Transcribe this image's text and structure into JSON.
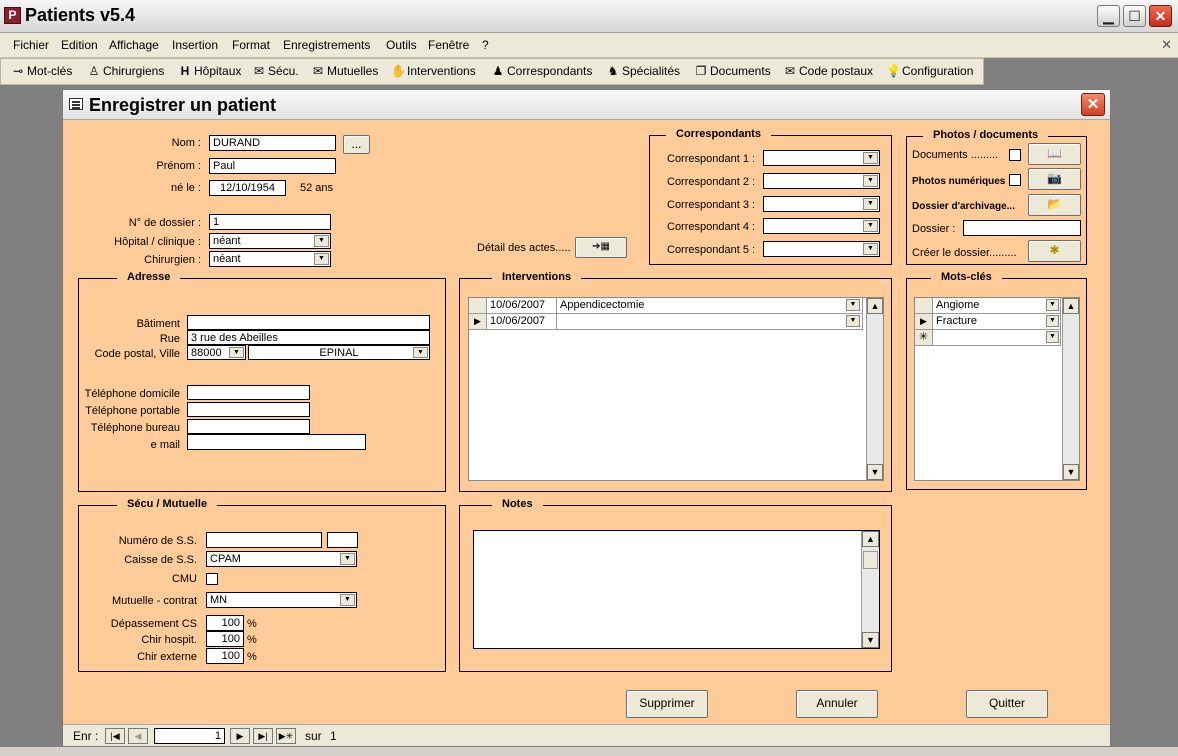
{
  "app": {
    "title": "Patients v5.4",
    "icon_letter": "P"
  },
  "menu": [
    "Fichier",
    "Edition",
    "Affichage",
    "Insertion",
    "Format",
    "Enregistrements",
    "Outils",
    "Fenêtre",
    "?"
  ],
  "toolbar": [
    {
      "label": "Mot-clés",
      "icon": "key-icon",
      "glyph": "⊸"
    },
    {
      "label": "Chirurgiens",
      "icon": "surgeon-icon",
      "glyph": "♙"
    },
    {
      "label": "Hôpitaux",
      "icon": "hospital-icon",
      "glyph": "H"
    },
    {
      "label": "Sécu.",
      "icon": "envelope-lock-icon",
      "glyph": "✉"
    },
    {
      "label": "Mutuelles",
      "icon": "envelope-icon",
      "glyph": "✉"
    },
    {
      "label": "Interventions",
      "icon": "hand-icon",
      "glyph": "✋"
    },
    {
      "label": "Correspondants",
      "icon": "person-icon",
      "glyph": "♟"
    },
    {
      "label": "Spécialités",
      "icon": "people-icon",
      "glyph": "♞"
    },
    {
      "label": "Documents",
      "icon": "documents-icon",
      "glyph": "❐"
    },
    {
      "label": "Code postaux",
      "icon": "mail-icon",
      "glyph": "✉"
    },
    {
      "label": "Configuration",
      "icon": "lightbulb-icon",
      "glyph": "💡"
    }
  ],
  "form": {
    "title": "Enregistrer un patient",
    "identity": {
      "nom_label": "Nom :",
      "nom_value": "DURAND",
      "browse_label": "...",
      "prenom_label": "Prénom :",
      "prenom_value": "Paul",
      "dob_label": "né le :",
      "dob_value": "12/10/1954",
      "age": "52 ans",
      "dossier_label": "N° de dossier :",
      "dossier_value": "1",
      "hopital_label": "Hôpital / clinique :",
      "hopital_value": "néant",
      "chirurgien_label": "Chirurgien :",
      "chirurgien_value": "néant"
    },
    "detail_actes_label": "Détail des actes.....",
    "correspondants": {
      "legend": "Correspondants",
      "items": [
        "Correspondant 1 :",
        "Correspondant 2 :",
        "Correspondant 3 :",
        "Correspondant 4 :",
        "Correspondant 5 :"
      ]
    },
    "photos": {
      "legend": "Photos / documents",
      "documents_label": "Documents .........",
      "photos_label": "Photos numériques",
      "archivage_label": "Dossier d'archivage...",
      "dossier_label": "Dossier :",
      "creer_label": "Créer le dossier........."
    },
    "adresse": {
      "legend": "Adresse",
      "batiment_label": "Bâtiment",
      "batiment_value": "",
      "rue_label": "Rue",
      "rue_value": "3 rue des Abeilles",
      "cp_label": "Code postal, Ville",
      "cp_value": "88000",
      "ville_value": "EPINAL",
      "tel_dom_label": "Téléphone domicile",
      "tel_port_label": "Téléphone portable",
      "tel_bur_label": "Téléphone bureau",
      "email_label": "e mail"
    },
    "interventions": {
      "legend": "Interventions",
      "rows": [
        {
          "date": "10/06/2007",
          "name": "Appendicectomie"
        },
        {
          "date": "10/06/2007",
          "name": ""
        }
      ]
    },
    "motscles": {
      "legend": "Mots-clés",
      "rows": [
        "Angiome",
        "Fracture",
        ""
      ]
    },
    "secu": {
      "legend": "Sécu / Mutuelle",
      "numss_label": "Numéro de S.S.",
      "caisse_label": "Caisse de S.S.",
      "caisse_value": "CPAM",
      "cmu_label": "CMU",
      "mutuelle_label": "Mutuelle - contrat",
      "mutuelle_value": "MN",
      "depassement_label": "Dépassement CS",
      "depassement_value": "100",
      "hospit_label": "Chir hospit.",
      "hospit_value": "100",
      "externe_label": "Chir externe",
      "externe_value": "100",
      "percent": "%"
    },
    "notes": {
      "legend": "Notes",
      "value": ""
    },
    "buttons": {
      "supprimer": "Supprimer",
      "annuler": "Annuler",
      "quitter": "Quitter"
    },
    "nav": {
      "enr_label": "Enr :",
      "record": "1",
      "sur_label": "sur",
      "total": "1"
    }
  }
}
